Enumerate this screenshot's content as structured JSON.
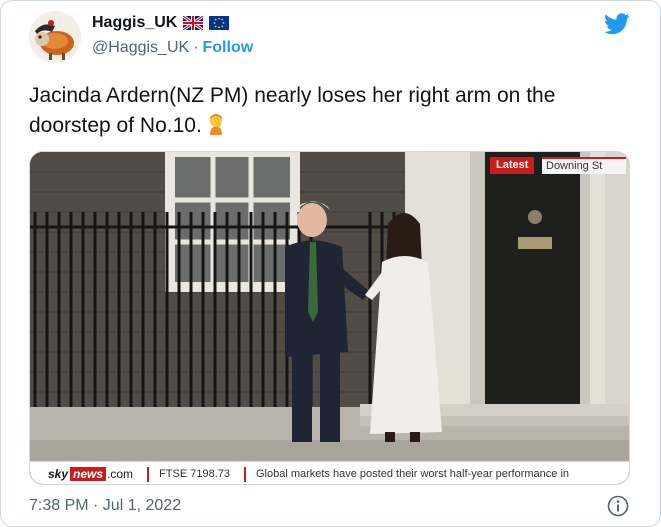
{
  "author": {
    "display_name": "Haggis_UK",
    "handle": "@Haggis_UK",
    "separator": "·",
    "follow_label": "Follow",
    "avatar_icon": "haggis-cartoon-avatar",
    "flags": [
      "uk-flag-icon",
      "eu-flag-icon"
    ]
  },
  "tweet": {
    "text": "Jacinda Ardern(NZ PM) nearly loses her right arm on the doorstep of No.10.",
    "emoji_icon": "facepalm-emoji",
    "timestamp": "7:38 PM · Jul 1, 2022"
  },
  "media": {
    "latest_label": "Latest",
    "location_label": "Downing St",
    "ticker": {
      "sky": "sky",
      "news": "news",
      "com": ".com",
      "ftse": "FTSE 7198.73",
      "headline": "Global markets have posted their worst half-year performance in"
    }
  },
  "colors": {
    "twitter_blue": "#1d9bf0",
    "text_primary": "#0f1419",
    "text_secondary": "#536471",
    "sky_red": "#cc1b1b"
  }
}
